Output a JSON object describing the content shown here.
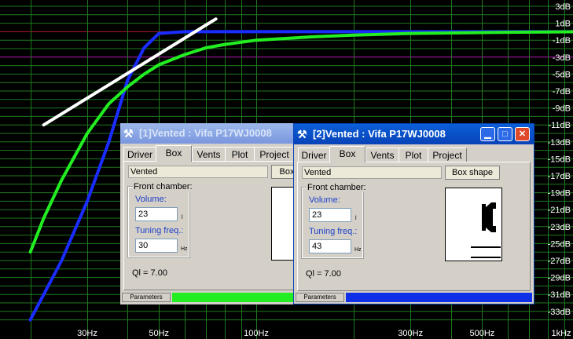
{
  "chart_data": {
    "type": "line",
    "x_scale": "log",
    "x_ticks": [
      "30Hz",
      "50Hz",
      "100Hz",
      "300Hz",
      "500Hz",
      "1kHz"
    ],
    "y_ticks": [
      "3dB",
      "1dB",
      "-1dB",
      "-3dB",
      "-5dB",
      "-7dB",
      "-9dB",
      "-11dB",
      "-13dB",
      "-15dB",
      "-17dB",
      "-19dB",
      "-21dB",
      "-23dB",
      "-25dB",
      "-27dB",
      "-29dB",
      "-31dB",
      "-33dB"
    ],
    "ylim": [
      -34,
      4
    ],
    "grid": true,
    "reference_lines": [
      {
        "y": 0,
        "color": "#b01830"
      },
      {
        "y": -3,
        "color": "#b01cb0"
      }
    ],
    "series": [
      {
        "color": "#1a2cff",
        "x": [
          20,
          25,
          30,
          35,
          40,
          45,
          50,
          60,
          70,
          80,
          100,
          200,
          500,
          1000
        ],
        "y": [
          -34,
          -27,
          -20,
          -13,
          -5.7,
          -1.9,
          -0.2,
          0.0,
          0.0,
          0.0,
          0.0,
          0.0,
          0.0,
          0.0
        ]
      },
      {
        "color": "#22ee22",
        "x": [
          20,
          22,
          25,
          30,
          35,
          40,
          45,
          50,
          60,
          70,
          80,
          100,
          150,
          200,
          300,
          500,
          1000
        ],
        "y": [
          -26,
          -22,
          -17.5,
          -12,
          -8.5,
          -6.5,
          -5,
          -3.9,
          -2.7,
          -1.9,
          -1.5,
          -1.0,
          -0.6,
          -0.4,
          -0.2,
          -0.1,
          0.0
        ]
      },
      {
        "color": "#ffffff",
        "x": [
          22,
          75
        ],
        "y": [
          -11,
          1.5
        ]
      }
    ]
  },
  "windows": [
    {
      "title": "[1]Vented : Vifa P17WJ0008",
      "tabs": [
        "Driver",
        "Box",
        "Vents",
        "Plot",
        "Project"
      ],
      "box_type": "Vented",
      "box_shape_button": "Box",
      "front_chamber_label": "Front chamber:",
      "volume_label": "Volume:",
      "volume_value": "23",
      "volume_unit": "l",
      "tuning_label": "Tuning freq.:",
      "tuning_value": "30",
      "tuning_unit": "Hz",
      "ql_text": "Ql = 7.00",
      "status_tab": "Parameters",
      "color": "#22ee22"
    },
    {
      "title": "[2]Vented : Vifa P17WJ0008",
      "tabs": [
        "Driver",
        "Box",
        "Vents",
        "Plot",
        "Project"
      ],
      "box_type": "Vented",
      "box_shape_button": "Box shape",
      "front_chamber_label": "Front chamber:",
      "volume_label": "Volume:",
      "volume_value": "23",
      "volume_unit": "l",
      "tuning_label": "Tuning freq.:",
      "tuning_value": "43",
      "tuning_unit": "Hz",
      "ql_text": "Ql = 7.00",
      "status_tab": "Parameters",
      "color": "#1030e8"
    }
  ]
}
